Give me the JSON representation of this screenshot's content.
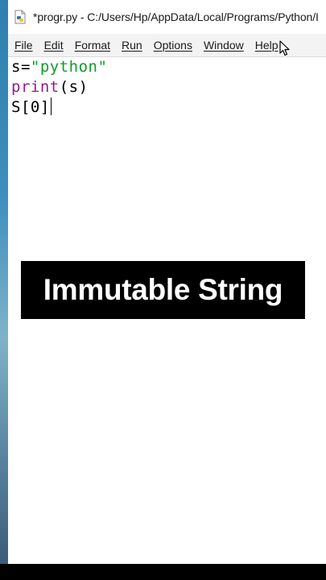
{
  "window": {
    "title": "*progr.py - C:/Users/Hp/AppData/Local/Programs/Python/I"
  },
  "menu": {
    "items": [
      {
        "label": "File"
      },
      {
        "label": "Edit"
      },
      {
        "label": "Format"
      },
      {
        "label": "Run"
      },
      {
        "label": "Options"
      },
      {
        "label": "Window"
      },
      {
        "label": "Help"
      }
    ]
  },
  "editor": {
    "lines": [
      {
        "var": "s=",
        "string": "\"python\""
      },
      {
        "builtin": "print",
        "rest": "(s)"
      },
      {
        "text": "S[0]"
      }
    ]
  },
  "caption": {
    "text": "Immutable String"
  },
  "colors": {
    "string": "#0f9d28",
    "builtin": "#8a1f8f",
    "caption_bg": "#000000",
    "caption_fg": "#ffffff",
    "menu_bg": "#f3f3f3"
  },
  "icons": {
    "app": "python-file-icon",
    "pointer": "mouse-pointer-icon"
  }
}
